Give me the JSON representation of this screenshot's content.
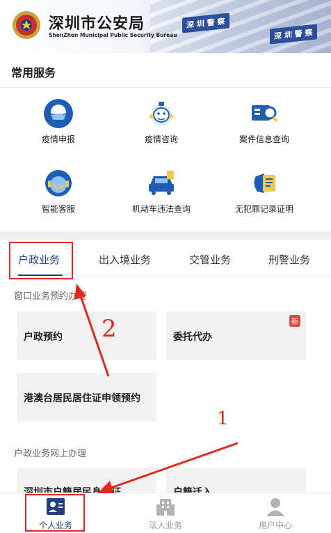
{
  "header": {
    "title": "深圳市公安局",
    "subtitle": "ShenZhen Municipal Public Security Bureau",
    "sign_left": "深 圳 警 察",
    "sign_right": "深 圳 警 察"
  },
  "common_services": {
    "title": "常用服务",
    "items": [
      {
        "label": "疫情申报",
        "icon": "mask-face-icon"
      },
      {
        "label": "疫情咨询",
        "icon": "mascot-icon"
      },
      {
        "label": "案件信息查询",
        "icon": "case-search-icon"
      },
      {
        "label": "智能客服",
        "icon": "robot-agent-icon"
      },
      {
        "label": "机动车违法查询",
        "icon": "vehicle-icon"
      },
      {
        "label": "无犯罪记录证明",
        "icon": "certificate-icon"
      }
    ]
  },
  "tabs": [
    {
      "label": "户政业务",
      "active": true
    },
    {
      "label": "出入境业务",
      "active": false
    },
    {
      "label": "交管业务",
      "active": false
    },
    {
      "label": "刑警业务",
      "active": false
    }
  ],
  "window_section": {
    "title": "窗口业务预约办理",
    "cards": [
      {
        "label": "户政预约"
      },
      {
        "label": "委托代办",
        "badge": "新"
      },
      {
        "label": "港澳台居民居住证申领预约"
      }
    ]
  },
  "online_section": {
    "title": "户政业务网上办理",
    "cards": [
      {
        "label": "深圳市户籍居民身份证"
      },
      {
        "label": "户籍迁入"
      }
    ]
  },
  "bottom_nav": [
    {
      "label": "个人业务",
      "active": true,
      "icon": "personal-id-icon"
    },
    {
      "label": "法人业务",
      "active": false,
      "icon": "building-icon"
    },
    {
      "label": "用户中心",
      "active": false,
      "icon": "user-icon"
    }
  ],
  "annotations": {
    "label_1": "1",
    "label_2": "2"
  },
  "colors": {
    "accent": "#1f3d86",
    "annotation": "#e0291f",
    "badge": "#e0463c"
  }
}
